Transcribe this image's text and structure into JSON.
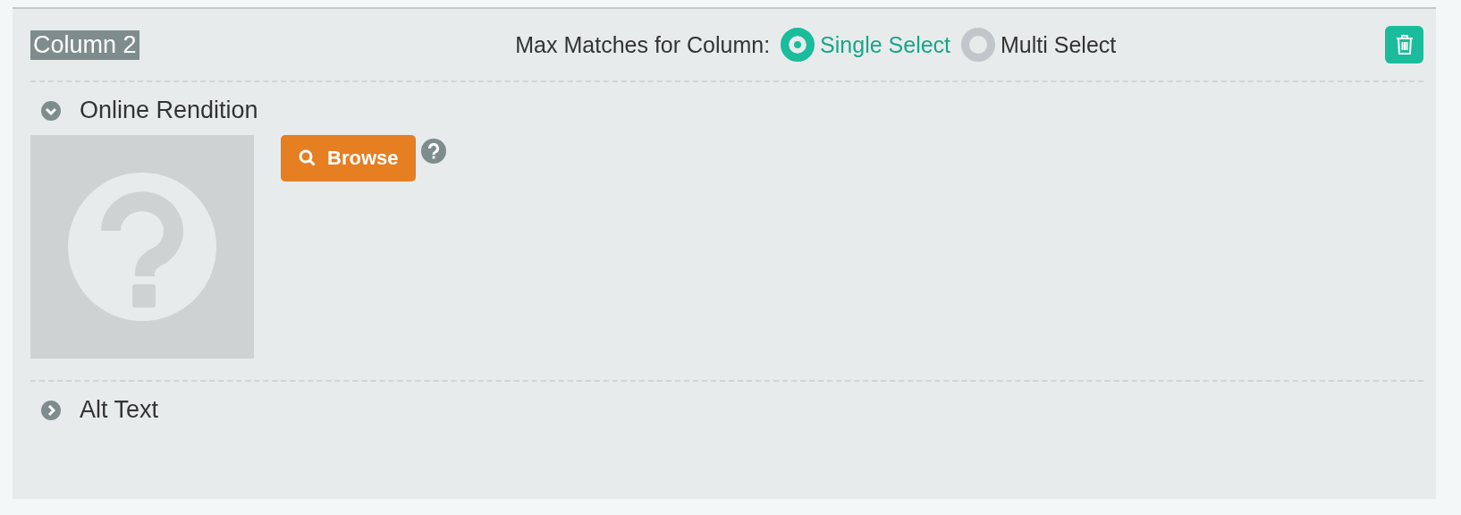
{
  "column": {
    "title": "Column 2",
    "max_matches": {
      "label": "Max Matches for Column:",
      "options": [
        {
          "label": "Single Select",
          "selected": true
        },
        {
          "label": "Multi Select",
          "selected": false
        }
      ]
    }
  },
  "sections": [
    {
      "title": "Online Rendition",
      "expanded": true,
      "browse_button": "Browse"
    },
    {
      "title": "Alt Text",
      "expanded": false
    }
  ]
}
